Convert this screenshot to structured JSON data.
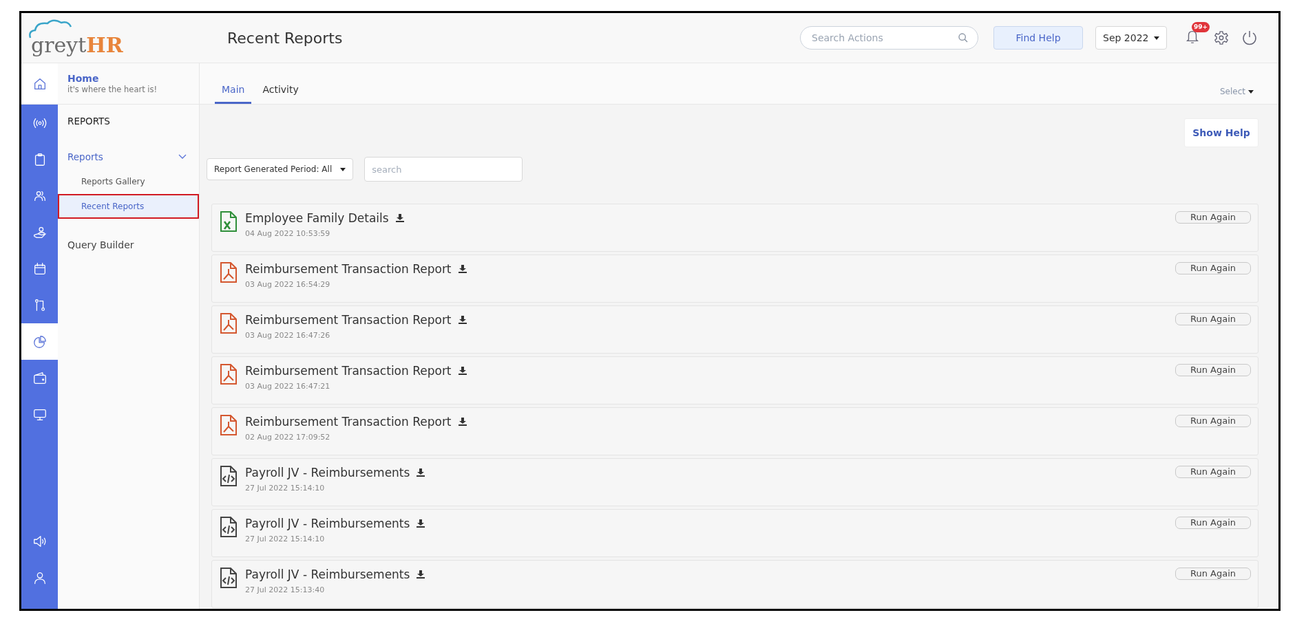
{
  "header": {
    "logo": {
      "word": "greyt",
      "accent": "HR"
    },
    "title": "Recent Reports",
    "search": {
      "placeholder": "Search Actions"
    },
    "find_help": "Find Help",
    "month": "Sep 2022",
    "notification_badge": "99+"
  },
  "home": {
    "title": "Home",
    "subtitle": "it's where the heart is!"
  },
  "rail": [
    {
      "kind": "broadcast",
      "selected": false
    },
    {
      "kind": "clipboard",
      "selected": false
    },
    {
      "kind": "people",
      "selected": false
    },
    {
      "kind": "hand",
      "selected": false
    },
    {
      "kind": "calendar",
      "selected": false
    },
    {
      "kind": "flow",
      "selected": false
    },
    {
      "kind": "pie",
      "selected": true
    },
    {
      "kind": "wallet",
      "selected": false
    },
    {
      "kind": "monitor",
      "selected": false
    }
  ],
  "rail_bottom": [
    {
      "kind": "speaker",
      "selected": false
    },
    {
      "kind": "user",
      "selected": false
    }
  ],
  "nav": {
    "section": "REPORTS",
    "items": [
      {
        "label": "Reports",
        "selected": true,
        "expanded": true,
        "children": [
          {
            "label": "Reports Gallery",
            "selected": false
          },
          {
            "label": "Recent Reports",
            "selected": true
          }
        ]
      },
      {
        "label": "Query Builder",
        "selected": false
      }
    ]
  },
  "tabs": [
    {
      "label": "Main",
      "selected": true
    },
    {
      "label": "Activity",
      "selected": false
    }
  ],
  "select": "Select",
  "show_help": "Show Help",
  "filter": {
    "period": "Report Generated Period: All",
    "search_placeholder": "search"
  },
  "reports": [
    {
      "kind": "excel",
      "name": "Employee Family Details",
      "time": "04 Aug 2022 10:53:59",
      "action": "Run Again"
    },
    {
      "kind": "pdf",
      "name": "Reimbursement Transaction Report",
      "time": "03 Aug 2022 16:54:29",
      "action": "Run Again"
    },
    {
      "kind": "pdf",
      "name": "Reimbursement Transaction Report",
      "time": "03 Aug 2022 16:47:26",
      "action": "Run Again"
    },
    {
      "kind": "pdf",
      "name": "Reimbursement Transaction Report",
      "time": "03 Aug 2022 16:47:21",
      "action": "Run Again"
    },
    {
      "kind": "pdf",
      "name": "Reimbursement Transaction Report",
      "time": "02 Aug 2022 17:09:52",
      "action": "Run Again"
    },
    {
      "kind": "code",
      "name": "Payroll JV - Reimbursements",
      "time": "27 Jul 2022 15:14:10",
      "action": "Run Again"
    },
    {
      "kind": "code",
      "name": "Payroll JV - Reimbursements",
      "time": "27 Jul 2022 15:14:10",
      "action": "Run Again"
    },
    {
      "kind": "code",
      "name": "Payroll JV - Reimbursements",
      "time": "27 Jul 2022 15:13:40",
      "action": "Run Again"
    }
  ]
}
